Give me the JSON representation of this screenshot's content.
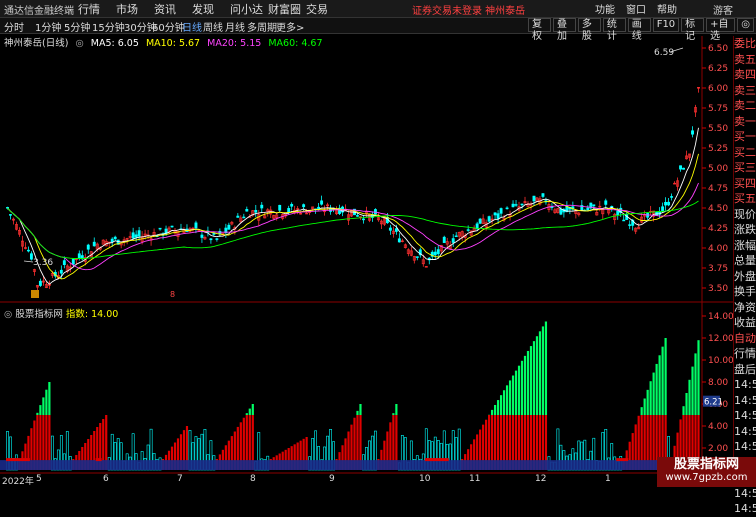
{
  "titlebar": {
    "app_name": "通达信金融终端",
    "menu": [
      "行情",
      "市场",
      "资讯",
      "发现",
      "问小达",
      "财富圈",
      "交易"
    ],
    "status": "证券交易未登录  神州泰岳",
    "right_tools": [
      "功能",
      "窗口",
      "帮助"
    ],
    "guest": "游客"
  },
  "periods": [
    "分时",
    "1分钟",
    "5分钟",
    "15分钟",
    "30分钟",
    "60分钟",
    "日线",
    "周线",
    "月线",
    "多周期",
    "更多>"
  ],
  "active_period": "日线",
  "toolbar_right": [
    "叠加",
    "多股",
    "统计",
    "画线",
    "F10",
    "标记",
    "+自选",
    "◎"
  ],
  "toolbar_first": "复权",
  "chart_head": {
    "name": "神州泰岳(日线)",
    "ma5": "MA5: 6.05",
    "ma10": "MA10: 5.67",
    "ma20": "MA20: 5.15",
    "ma60": "MA60: 4.67"
  },
  "colors": {
    "ma5": "#ffffff",
    "ma10": "#ffff00",
    "ma20": "#ff40ff",
    "ma60": "#00ff00",
    "up": "#ff3030",
    "down": "#00ffff"
  },
  "price_axis": [
    "6.50",
    "6.25",
    "6.00",
    "5.75",
    "5.50",
    "5.25",
    "5.00",
    "4.75",
    "4.50",
    "4.25",
    "4.00",
    "3.75",
    "3.50"
  ],
  "annotations": {
    "high": "6.59",
    "low": "3.36",
    "marker": "8"
  },
  "indicator_head": {
    "name": "股票指标网",
    "value": "指数: 14.00"
  },
  "indicator_axis": [
    "14.00",
    "12.00",
    "10.00",
    "8.00",
    "6.00",
    "4.00",
    "2.00"
  ],
  "indicator_current": "6.21",
  "right_panel": [
    "委比",
    "卖五",
    "卖四",
    "卖三",
    "卖二",
    "卖一",
    "买一",
    "买二",
    "买三",
    "买四",
    "买五",
    "现价",
    "涨跌",
    "涨幅",
    "总量",
    "外盘",
    "换手",
    "净资",
    "收益",
    "自动",
    "行情",
    "盘后",
    "14:50",
    "14:50",
    "14:50",
    "14:50",
    "14:50",
    "14:50",
    "14:50",
    "14:50",
    "14:50"
  ],
  "right_panel_red": [
    0,
    1,
    2,
    3,
    4,
    5,
    6,
    7,
    8,
    9,
    10,
    19
  ],
  "dates": [
    "2022年",
    "5",
    "6",
    "7",
    "8",
    "9",
    "10",
    "11",
    "12",
    "1"
  ],
  "watermark": {
    "line1": "股票指标网",
    "line2": "www.7gpzb.com"
  }
}
